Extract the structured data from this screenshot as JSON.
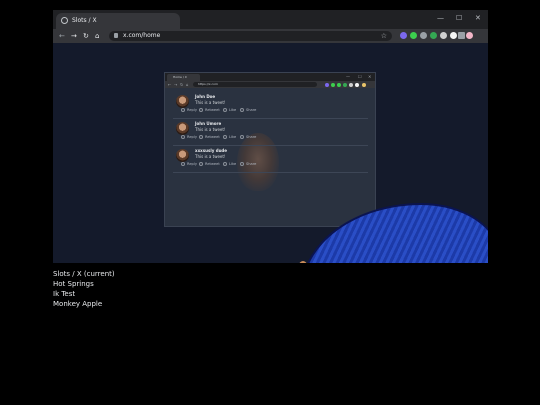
{
  "outer_browser": {
    "tab_title": "Slots / X",
    "url": "x.com/home",
    "window_controls": {
      "minimize": "—",
      "maximize": "☐",
      "close": "✕"
    },
    "nav": {
      "back": "←",
      "forward": "→",
      "reload": "↻",
      "home": "⌂"
    },
    "star": "☆",
    "extensions": [
      {
        "name": "ext-icon-1",
        "color": "#7b68ee"
      },
      {
        "name": "ext-icon-2",
        "color": "#3ccf4e"
      },
      {
        "name": "ext-icon-3",
        "color": "#9aa0a6"
      },
      {
        "name": "ext-icon-4",
        "color": "#34a853"
      },
      {
        "name": "ext-icon-5",
        "color": "#d0d0d0"
      },
      {
        "name": "ext-icon-6",
        "color": "#f5f5f5"
      },
      {
        "name": "puzzle-icon",
        "color": "#9aa0a6"
      },
      {
        "name": "profile-avatar",
        "color": "#f3b6c8"
      }
    ]
  },
  "inner_browser": {
    "tab_title": "Home / X",
    "url": "https://x.com",
    "window_controls": {
      "minimize": "—",
      "maximize": "☐",
      "close": "✕"
    },
    "nav": {
      "back": "←",
      "forward": "→",
      "reload": "↻",
      "home": "⌂"
    }
  },
  "tweets": [
    {
      "name": "John Doe",
      "text": "This is a tweet!"
    },
    {
      "name": "John Umore",
      "text": "This is a tweet!"
    },
    {
      "name": "xxxsusly dude",
      "text": "This is a tweet!"
    }
  ],
  "tweet_actions": {
    "reply": "Reply",
    "retweet": "Retweet",
    "like": "Like",
    "share": "Share"
  },
  "tab_list": [
    "Slots / X (current)",
    "Hot Springs",
    "Ik Test",
    "Monkey Apple"
  ]
}
